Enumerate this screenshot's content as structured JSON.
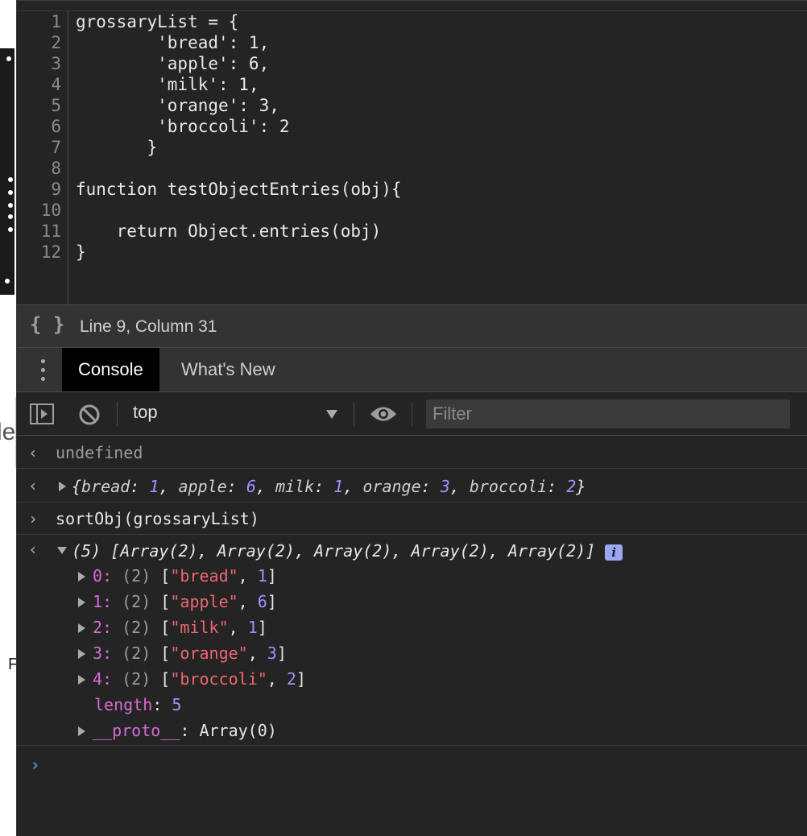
{
  "editor": {
    "lines": [
      {
        "n": "1",
        "text": "grossaryList = {"
      },
      {
        "n": "2",
        "text": "        'bread': 1,"
      },
      {
        "n": "3",
        "text": "        'apple': 6,"
      },
      {
        "n": "4",
        "text": "        'milk': 1,"
      },
      {
        "n": "5",
        "text": "        'orange': 3,"
      },
      {
        "n": "6",
        "text": "        'broccoli': 2"
      },
      {
        "n": "7",
        "text": "       }"
      },
      {
        "n": "8",
        "text": ""
      },
      {
        "n": "9",
        "text": "function testObjectEntries(obj){"
      },
      {
        "n": "10",
        "text": ""
      },
      {
        "n": "11",
        "text": "    return Object.entries(obj)"
      },
      {
        "n": "12",
        "text": "}"
      }
    ]
  },
  "statusbar": {
    "icon": "{ }",
    "position": "Line 9, Column 31"
  },
  "drawer": {
    "tab_console": "Console",
    "tab_whats_new": "What's New"
  },
  "toolbar": {
    "context": "top",
    "filter_placeholder": "Filter"
  },
  "console": {
    "msg1": "undefined",
    "msg2": {
      "open": "{",
      "pairs": [
        {
          "k": "bread",
          "v": "1"
        },
        {
          "k": "apple",
          "v": "6"
        },
        {
          "k": "milk",
          "v": "1"
        },
        {
          "k": "orange",
          "v": "3"
        },
        {
          "k": "broccoli",
          "v": "2"
        }
      ],
      "close": "}"
    },
    "input": "sortObj(grossaryList)",
    "result_summary": "(5) [Array(2), Array(2), Array(2), Array(2), Array(2)]",
    "info": "i",
    "entries": [
      {
        "idx": "0",
        "len": "(2)",
        "str": "\"bread\"",
        "num": "1"
      },
      {
        "idx": "1",
        "len": "(2)",
        "str": "\"apple\"",
        "num": "6"
      },
      {
        "idx": "2",
        "len": "(2)",
        "str": "\"milk\"",
        "num": "1"
      },
      {
        "idx": "3",
        "len": "(2)",
        "str": "\"orange\"",
        "num": "3"
      },
      {
        "idx": "4",
        "len": "(2)",
        "str": "\"broccoli\"",
        "num": "2"
      }
    ],
    "length_key": "length",
    "length_val": "5",
    "proto_key": "__proto__",
    "proto_val": "Array(0)"
  },
  "page_fragments": {
    "frag1": "le",
    "frag2": "F"
  },
  "colors": {
    "background": "#242424",
    "string": "#f0666f",
    "number": "#9d93ff",
    "property": "#d66bd6",
    "prompt_blue": "#4a90e8"
  }
}
